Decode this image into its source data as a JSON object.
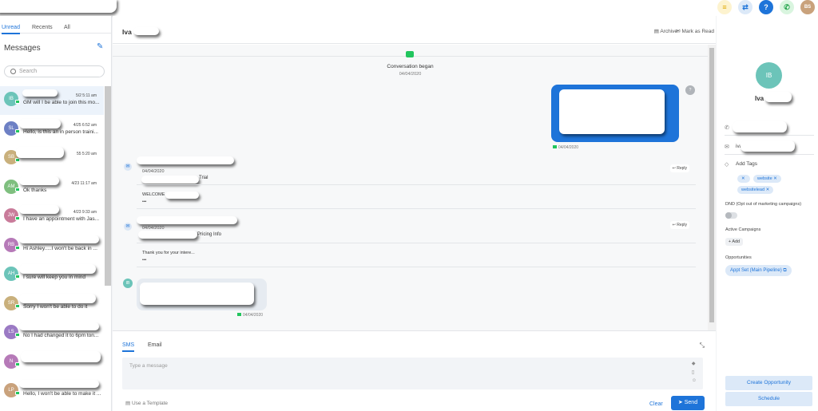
{
  "topbar": {
    "icons": [
      {
        "name": "list-icon",
        "glyph": "≡",
        "bg": "#fdf3cf",
        "fg": "#e0a800"
      },
      {
        "name": "swap-icon",
        "glyph": "⇄",
        "bg": "#dce9f8",
        "fg": "#1e74d9"
      },
      {
        "name": "help-icon",
        "glyph": "?",
        "bg": "#1e74d9",
        "fg": "#ffffff"
      },
      {
        "name": "phone-icon",
        "glyph": "✆",
        "bg": "#d9f5df",
        "fg": "#22a34a"
      }
    ],
    "user_initials": "BS"
  },
  "sidebar": {
    "tabs": [
      "Unread",
      "Recents",
      "All"
    ],
    "title": "Messages",
    "search_placeholder": "Search",
    "items": [
      {
        "initials": "IB",
        "color": "#6cc4b9",
        "time": "5/2 5:11 am",
        "preview": "GM will I be able to join this mo..."
      },
      {
        "initials": "SL",
        "color": "#6d80c4",
        "time": "4/25 6:52 am",
        "preview": "Hello, is this an in person traini..."
      },
      {
        "initials": "SB",
        "color": "#c9b07c",
        "time": "55 5:20 am",
        "preview": ""
      },
      {
        "initials": "AM",
        "color": "#7fbf7f",
        "time": "4/23 11:17 am",
        "preview": "Ok thanks"
      },
      {
        "initials": "JW",
        "color": "#c97b9a",
        "time": "4/23 9:33 am",
        "preview": "I have an appointment with Jas..."
      },
      {
        "initials": "RB",
        "color": "#b67ab8",
        "time": "",
        "preview": "Hi Ashley.....I won't be back in ..."
      },
      {
        "initials": "AH",
        "color": "#6cc4b9",
        "time": "",
        "preview": "I sure will keep you in mind"
      },
      {
        "initials": "SR",
        "color": "#c9b07c",
        "time": "",
        "preview": "Sorry I won't be able to do it"
      },
      {
        "initials": "LS",
        "color": "#9b7ac4",
        "time": "",
        "preview": "No I had changed it to 6pm ton..."
      },
      {
        "initials": "N",
        "color": "#b67ab8",
        "time": "",
        "preview": ""
      },
      {
        "initials": "LP",
        "color": "#c9a27c",
        "time": "",
        "preview": "Hello, I won't be able to make it ..."
      }
    ]
  },
  "chat": {
    "contact_name": "Iva",
    "archive_label": "Archive",
    "mark_read_label": "Mark as Read",
    "began_label": "Conversation began",
    "began_date": "04/04/2020",
    "outgoing": {
      "avatar": "?",
      "date": "04/04/2020"
    },
    "emails": [
      {
        "date": "04/04/2020",
        "subject": "Trial",
        "body": "WELCOME",
        "more": "•••",
        "reply": "Reply"
      },
      {
        "date": "04/04/2020",
        "subject": "Pricing Info",
        "body": "Thank you for your intere...",
        "more": "•••",
        "reply": "Reply"
      }
    ],
    "incoming": {
      "date": "04/04/2020"
    }
  },
  "composer": {
    "tabs": [
      "SMS",
      "Email"
    ],
    "placeholder": "Type a message",
    "template_label": "Use a Template",
    "clear_label": "Clear",
    "send_label": "Send"
  },
  "contact": {
    "initials": "IB",
    "name": "Iva",
    "email_prefix": "iva",
    "add_tags_label": "Add Tags",
    "tags": [
      "website",
      "websitelead"
    ],
    "dnd_label": "DND (Opt out of marketing campaigns)",
    "campaigns_label": "Active Campaigns",
    "add_label": "Add",
    "opportunities_label": "Opportunities",
    "opportunity": "Appt Set (Main Pipeline)",
    "create_opportunity_label": "Create Opportunity",
    "schedule_label": "Schedule"
  }
}
